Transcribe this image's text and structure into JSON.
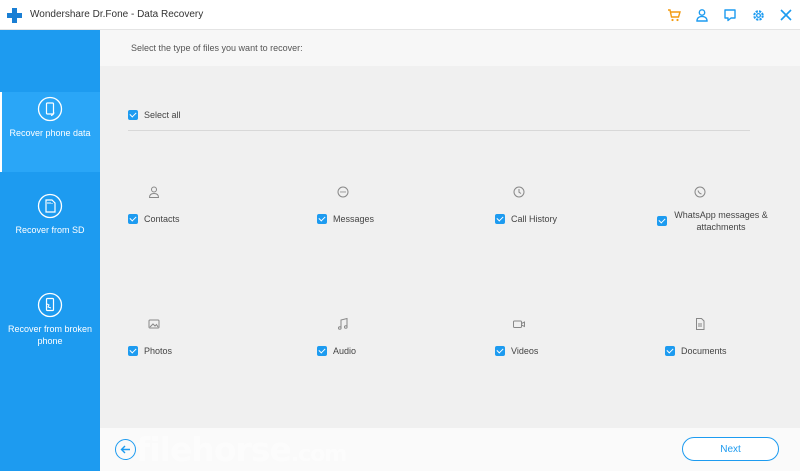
{
  "window": {
    "title": "Wondershare Dr.Fone - Data Recovery"
  },
  "toolbar": {
    "icons": [
      "cart-icon",
      "user-icon",
      "feedback-icon",
      "settings-icon",
      "close-icon"
    ]
  },
  "sidebar": {
    "items": [
      {
        "label": "Recover phone data",
        "icon": "phone-recover-icon",
        "active": true
      },
      {
        "label": "Recover from SD",
        "icon": "sd-card-icon",
        "active": false
      },
      {
        "label": "Recover from broken phone",
        "icon": "broken-phone-icon",
        "active": false
      }
    ]
  },
  "main": {
    "prompt": "Select the type of files you want to recover:",
    "select_all": "Select all",
    "file_types": [
      {
        "label": "Contacts",
        "icon": "contact-icon",
        "checked": true
      },
      {
        "label": "Messages",
        "icon": "message-icon",
        "checked": true
      },
      {
        "label": "Call History",
        "icon": "clock-icon",
        "checked": true
      },
      {
        "label": "WhatsApp messages & attachments",
        "icon": "whatsapp-icon",
        "checked": true
      },
      {
        "label": "Photos",
        "icon": "photo-icon",
        "checked": true
      },
      {
        "label": "Audio",
        "icon": "music-icon",
        "checked": true
      },
      {
        "label": "Videos",
        "icon": "video-icon",
        "checked": true
      },
      {
        "label": "Documents",
        "icon": "document-icon",
        "checked": true
      }
    ]
  },
  "footer": {
    "next_label": "Next"
  },
  "watermark": {
    "text": "filehorse",
    "suffix": ".com"
  },
  "colors": {
    "accent": "#1d9bf0",
    "cart": "#f39c12"
  }
}
